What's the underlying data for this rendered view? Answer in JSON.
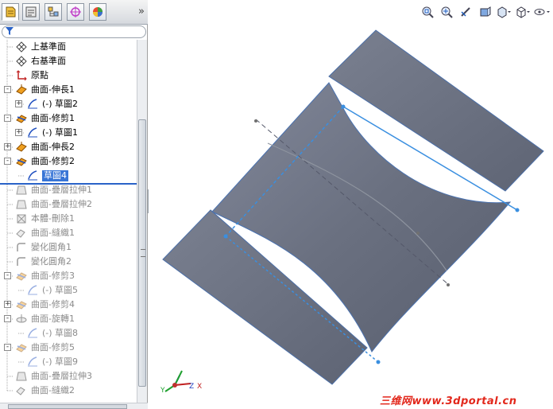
{
  "tabs": {
    "items": [
      "featuremanager-tab",
      "propertymanager-tab",
      "configurationmanager-tab",
      "dimxpert-tab",
      "display-manager-tab"
    ],
    "more": "»"
  },
  "filter": {
    "icon": "filter-icon"
  },
  "tree": [
    {
      "label": "上基準面",
      "icon": "plane-icon",
      "level": 1,
      "expander": "",
      "state": "normal"
    },
    {
      "label": "右基準面",
      "icon": "plane-icon",
      "level": 1,
      "expander": "",
      "state": "normal"
    },
    {
      "label": "原點",
      "icon": "origin-icon",
      "level": 1,
      "expander": "",
      "state": "normal"
    },
    {
      "label": "曲面-伸長1",
      "icon": "surface-extrude-icon",
      "level": 1,
      "expander": "-",
      "state": "normal"
    },
    {
      "label": "(-) 草圖2",
      "icon": "sketch-icon",
      "level": 2,
      "expander": "+",
      "state": "normal"
    },
    {
      "label": "曲面-修剪1",
      "icon": "surface-trim-icon",
      "level": 1,
      "expander": "-",
      "state": "normal"
    },
    {
      "label": "(-) 草圖1",
      "icon": "sketch-icon",
      "level": 2,
      "expander": "+",
      "state": "normal"
    },
    {
      "label": "曲面-伸長2",
      "icon": "surface-extrude-icon",
      "level": 1,
      "expander": "+",
      "state": "normal"
    },
    {
      "label": "曲面-修剪2",
      "icon": "surface-trim-icon",
      "level": 1,
      "expander": "-",
      "state": "normal"
    },
    {
      "label": "草圖4",
      "icon": "sketch-icon",
      "level": 2,
      "expander": "",
      "state": "selected"
    },
    {
      "label": "曲面-疊層拉伸1",
      "icon": "surface-loft-icon",
      "level": 1,
      "expander": "",
      "state": "dim"
    },
    {
      "label": "曲面-疊層拉伸2",
      "icon": "surface-loft-icon",
      "level": 1,
      "expander": "",
      "state": "dim"
    },
    {
      "label": "本體-刪除1",
      "icon": "delete-body-icon",
      "level": 1,
      "expander": "",
      "state": "dim"
    },
    {
      "label": "曲面-縫織1",
      "icon": "surface-knit-icon",
      "level": 1,
      "expander": "",
      "state": "dim"
    },
    {
      "label": "變化圓角1",
      "icon": "fillet-icon",
      "level": 1,
      "expander": "",
      "state": "dim"
    },
    {
      "label": "變化圓角2",
      "icon": "fillet-icon",
      "level": 1,
      "expander": "",
      "state": "dim"
    },
    {
      "label": "曲面-修剪3",
      "icon": "surface-trim-icon",
      "level": 1,
      "expander": "-",
      "state": "dim"
    },
    {
      "label": "(-) 草圖5",
      "icon": "sketch-icon",
      "level": 2,
      "expander": "",
      "state": "dim"
    },
    {
      "label": "曲面-修剪4",
      "icon": "surface-trim-icon",
      "level": 1,
      "expander": "+",
      "state": "dim"
    },
    {
      "label": "曲面-旋轉1",
      "icon": "surface-revolve-icon",
      "level": 1,
      "expander": "-",
      "state": "dim"
    },
    {
      "label": "(-) 草圖8",
      "icon": "sketch-icon",
      "level": 2,
      "expander": "",
      "state": "dim"
    },
    {
      "label": "曲面-修剪5",
      "icon": "surface-trim-icon",
      "level": 1,
      "expander": "-",
      "state": "dim"
    },
    {
      "label": "(-) 草圖9",
      "icon": "sketch-icon",
      "level": 2,
      "expander": "",
      "state": "dim"
    },
    {
      "label": "曲面-疊層拉伸3",
      "icon": "surface-loft-icon",
      "level": 1,
      "expander": "",
      "state": "dim"
    },
    {
      "label": "曲面-縫織2",
      "icon": "surface-knit-icon",
      "level": 1,
      "expander": "",
      "state": "dim"
    }
  ],
  "toolbar": {
    "items": [
      "zoom-to-fit-icon",
      "zoom-area-icon",
      "previous-view-icon",
      "section-view-icon",
      "view-orientation-icon",
      "display-style-icon",
      "hide-show-icon"
    ]
  },
  "triad": {
    "x": "X",
    "y": "Y",
    "z": "Z"
  },
  "watermark": "三维网www.3dportal.cn",
  "colors": {
    "surface": "#6c7282",
    "selection": "#3875d6",
    "sketch": "#3a8fe0",
    "watermark": "#e2271b"
  }
}
